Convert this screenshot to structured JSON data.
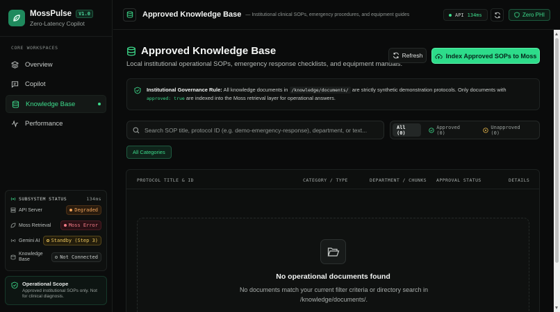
{
  "brand": {
    "name": "MossPulse",
    "version": "V1.0",
    "tagline": "Zero-Latency Copilot"
  },
  "sidebar": {
    "section_label": "CORE WORKSPACES",
    "items": [
      {
        "label": "Overview",
        "icon": "layers-icon"
      },
      {
        "label": "Copilot",
        "icon": "chat-icon"
      },
      {
        "label": "Knowledge Base",
        "icon": "database-icon",
        "active": true
      },
      {
        "label": "Performance",
        "icon": "activity-icon"
      }
    ],
    "status": {
      "title": "SUBSYSTEM STATUS",
      "latency": "134ms",
      "rows": [
        {
          "label": "API Server",
          "value": "Degraded"
        },
        {
          "label": "Moss Retrieval",
          "value": "Moss Error"
        },
        {
          "label": "Gemini AI",
          "value": "Standby (Step 3)"
        },
        {
          "label": "Knowledge Base",
          "value": "Not Connected"
        }
      ]
    },
    "scope": {
      "title": "Operational Scope",
      "text": "Approved institutional SOPs only. Not for clinical diagnosis."
    }
  },
  "topbar": {
    "title": "Approved Knowledge Base",
    "subtitle": "— Institutional clinical SOPs, emergency procedures, and equipment guides",
    "api_label": "API",
    "api_latency": "134ms",
    "phi_label": "Zero PHI"
  },
  "page": {
    "title": "Approved Knowledge Base",
    "subtitle": "Local institutional operational SOPs, emergency response checklists, and equipment manuals.",
    "refresh_label": "Refresh",
    "index_label": "Index Approved SOPs to Moss",
    "governance": {
      "heading": "Institutional Governance Rule:",
      "text_a": "All knowledge documents in",
      "path": "/knowledge/documents/",
      "text_b": "are strictly synthetic demonstration protocols. Only documents with",
      "flag": "approved: true",
      "text_c": "are indexed into the Moss retrieval layer for operational answers."
    },
    "search_placeholder": "Search SOP title, protocol ID (e.g. demo-emergency-response), department, or text...",
    "filters": [
      "All (0)",
      "Approved (0)",
      "Unapproved (0)"
    ],
    "category_label": "All Categories",
    "table": {
      "columns": [
        "PROTOCOL TITLE & ID",
        "CATEGORY / TYPE",
        "DEPARTMENT / CHUNKS",
        "APPROVAL STATUS",
        "DETAILS"
      ],
      "empty_title": "No operational documents found",
      "empty_text": "No documents match your current filter criteria or directory search in /knowledge/documents/."
    }
  },
  "colors": {
    "accent": "#2ddc8a",
    "background": "#0a0b0b"
  }
}
